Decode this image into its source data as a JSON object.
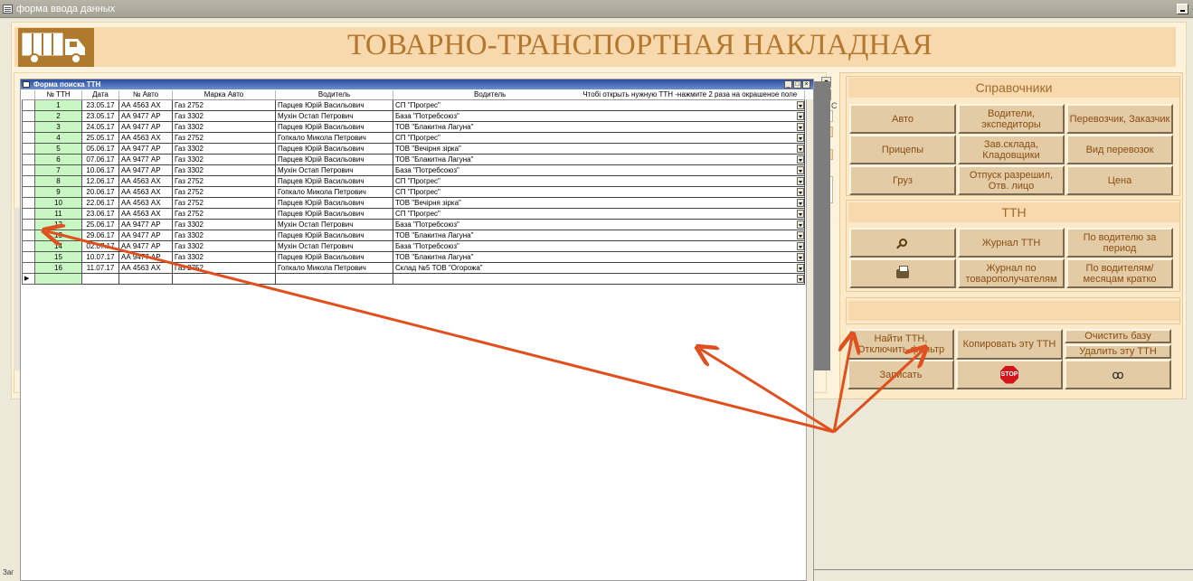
{
  "window": {
    "title": "форма ввода данных"
  },
  "header": {
    "title": "ТОВАРНО-ТРАНСПОРТНАЯ НАКЛАДНАЯ"
  },
  "search_form": {
    "title": "Форма поиска ТТН",
    "hint": "Чтобі открыть нужную ТТН -нажмите 2 раза на окрашеное поле",
    "columns": [
      "№ ТТН",
      "Дата",
      "№ Авто",
      "Марка Авто",
      "Водитель",
      "Водитель"
    ],
    "rows": [
      [
        "1",
        "23.05.17",
        "АА 4563 АХ",
        "Газ 2752",
        "Парцев Юрій Васильович",
        "СП \"Прогрес\""
      ],
      [
        "2",
        "23.05.17",
        "АА 9477 АР",
        "Газ 3302",
        "Мухін Остап Петрович",
        "База \"Потребсоюз\""
      ],
      [
        "3",
        "24.05.17",
        "АА 9477 АР",
        "Газ 3302",
        "Парцев Юрій Васильович",
        "ТОВ \"Блакитна Лагуна\""
      ],
      [
        "4",
        "25.05.17",
        "АА 4563 АХ",
        "Газ 2752",
        "Гопкало Микола Петрович",
        "СП \"Прогрес\""
      ],
      [
        "5",
        "05.06.17",
        "АА 9477 АР",
        "Газ 3302",
        "Парцев Юрій Васильович",
        "ТОВ \"Вечірня зірка\""
      ],
      [
        "6",
        "07.06.17",
        "АА 9477 АР",
        "Газ 3302",
        "Парцев Юрій Васильович",
        "ТОВ \"Блакитна Лагуна\""
      ],
      [
        "7",
        "10.06.17",
        "АА 9477 АР",
        "Газ 3302",
        "Мухін Остап Петрович",
        "База \"Потребсоюз\""
      ],
      [
        "8",
        "12.06.17",
        "АА 4563 АХ",
        "Газ 2752",
        "Парцев Юрій Васильович",
        "СП \"Прогрес\""
      ],
      [
        "9",
        "20.06.17",
        "АА 4563 АХ",
        "Газ 2752",
        "Гопкало Микола Петрович",
        "СП \"Прогрес\""
      ],
      [
        "10",
        "22.06.17",
        "АА 4563 АХ",
        "Газ 2752",
        "Парцев Юрій Васильович",
        "ТОВ \"Вечірня зірка\""
      ],
      [
        "11",
        "23.06.17",
        "АА 4563 АХ",
        "Газ 2752",
        "Парцев Юрій Васильович",
        "СП \"Прогрес\""
      ],
      [
        "12",
        "25.06.17",
        "АА 9477 АР",
        "Газ 3302",
        "Мухін Остап Петрович",
        "База \"Потребсоюз\""
      ],
      [
        "13",
        "29.06.17",
        "АА 9477 АР",
        "Газ 3302",
        "Парцев Юрій Васильович",
        "ТОВ \"Блакитна Лагуна\""
      ],
      [
        "14",
        "02.07.17",
        "АА 9477 АР",
        "Газ 3302",
        "Мухін Остап Петрович",
        "База \"Потребсоюз\""
      ],
      [
        "15",
        "10.07.17",
        "АА 9477 АР",
        "Газ 3302",
        "Парцев Юрій Васильович",
        "ТОВ \"Блакитна Лагуна\""
      ],
      [
        "16",
        "11.07.17",
        "АА 4563 АХ",
        "Газ 2752",
        "Гопкало Микола Петрович",
        "Склад №5 ТОВ \"Огорожа\""
      ]
    ]
  },
  "spravochniki": {
    "title": "Справочники",
    "buttons": [
      "Авто",
      "Водители, экспедиторы",
      "Перевозчик, Заказчик",
      "Прицепы",
      "Зав.склада, Кладовщики",
      "Вид перевозок",
      "Груз",
      "Отпуск разрешил, Отв. лицо",
      "Цена"
    ]
  },
  "ttn": {
    "title": "ТТН",
    "buttons": [
      "Журнал ТТН",
      "По водителю за период",
      "Журнал по товарополучателям",
      "По водителям/ месяцам кратко"
    ]
  },
  "actions": {
    "find": "Найти ТТН, Отключить фильтр",
    "copy": "Копировать эту ТТН",
    "clear": "Очистить базу",
    "delete": "Удалить эту ТТН",
    "save": "Записать",
    "stop": "STOP"
  },
  "misc": {
    "peek_text": "13. C",
    "record_label": "Заг"
  },
  "colors": {
    "accent": "#b5772e",
    "button_text": "#8a4e14",
    "arrow": "#e0501e",
    "row_number_bg": "#c8f7c4"
  }
}
